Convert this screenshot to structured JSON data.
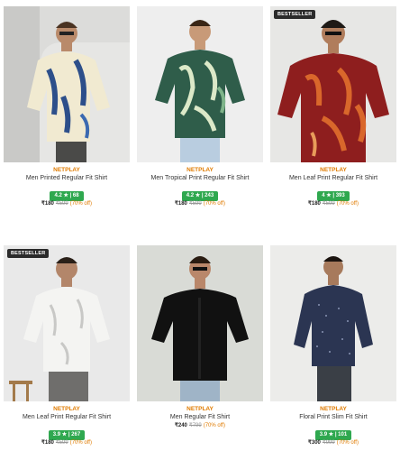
{
  "products": [
    {
      "badge": "",
      "brand": "NETPLAY",
      "title": "Men Printed Regular Fit Shirt",
      "rating": "4.2 ★ | 68",
      "price": "₹180",
      "mrp": "₹599",
      "discount": "(70% off)"
    },
    {
      "badge": "",
      "brand": "NETPLAY",
      "title": "Men Tropical Print Regular Fit Shirt",
      "rating": "4.2 ★ | 243",
      "price": "₹180",
      "mrp": "₹599",
      "discount": "(70% off)"
    },
    {
      "badge": "BESTSELLER",
      "brand": "NETPLAY",
      "title": "Men Leaf Print Regular Fit Shirt",
      "rating": "4 ★ | 393",
      "price": "₹180",
      "mrp": "₹599",
      "discount": "(70% off)"
    },
    {
      "badge": "BESTSELLER",
      "brand": "NETPLAY",
      "title": "Men Leaf Print Regular Fit Shirt",
      "rating": "3.9 ★ | 267",
      "price": "₹180",
      "mrp": "₹599",
      "discount": "(70% off)"
    },
    {
      "badge": "",
      "brand": "NETPLAY",
      "title": "Men Regular Fit Shirt",
      "rating": "",
      "price": "₹240",
      "mrp": "₹799",
      "discount": "(70% off)"
    },
    {
      "badge": "",
      "brand": "NETPLAY",
      "title": "Floral Print Slim Fit Shirt",
      "rating": "3.9 ★ | 101",
      "price": "₹300",
      "mrp": "₹999",
      "discount": "(70% off)"
    }
  ],
  "colors": {
    "brand": "#e07b00",
    "rating_bg": "#2fa84f",
    "badge_bg": "#2b2b2b"
  }
}
